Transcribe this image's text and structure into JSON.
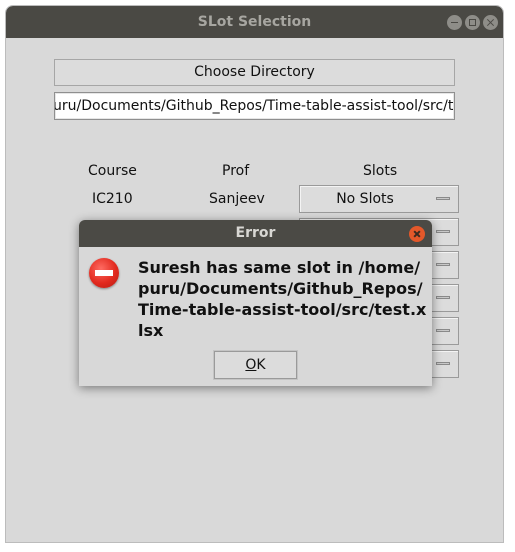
{
  "window": {
    "title": "SLot Selection"
  },
  "main": {
    "choose_button": "Choose Directory",
    "path_value": "uru/Documents/Github_Repos/Time-table-assist-tool/src/test",
    "headers": {
      "course": "Course",
      "prof": "Prof",
      "slots": "Slots"
    },
    "rows": [
      {
        "course": "IC210",
        "prof": "Sanjeev",
        "slot": "No Slots"
      },
      {
        "course": "",
        "prof": "",
        "slot": ""
      },
      {
        "course": "",
        "prof": "",
        "slot": ""
      },
      {
        "course": "",
        "prof": "",
        "slot": ""
      },
      {
        "course": "",
        "prof": "",
        "slot": ""
      },
      {
        "course": "",
        "prof": "",
        "slot": ""
      }
    ]
  },
  "dialog": {
    "title": "Error",
    "message": "Suresh has same slot in /home/puru/Documents/Github_Repos/Time-table-assist-tool/src/test.xlsx",
    "ok_mnemonic": "O",
    "ok_rest": "K"
  },
  "colors": {
    "titlebar": "#4a4944",
    "window_bg": "#d9d9d9",
    "close_accent": "#e4582a",
    "error_red": "#e22a1f"
  },
  "icons": [
    "minimize-icon",
    "maximize-icon",
    "close-icon",
    "dropdown-indicator-icon",
    "error-icon"
  ]
}
